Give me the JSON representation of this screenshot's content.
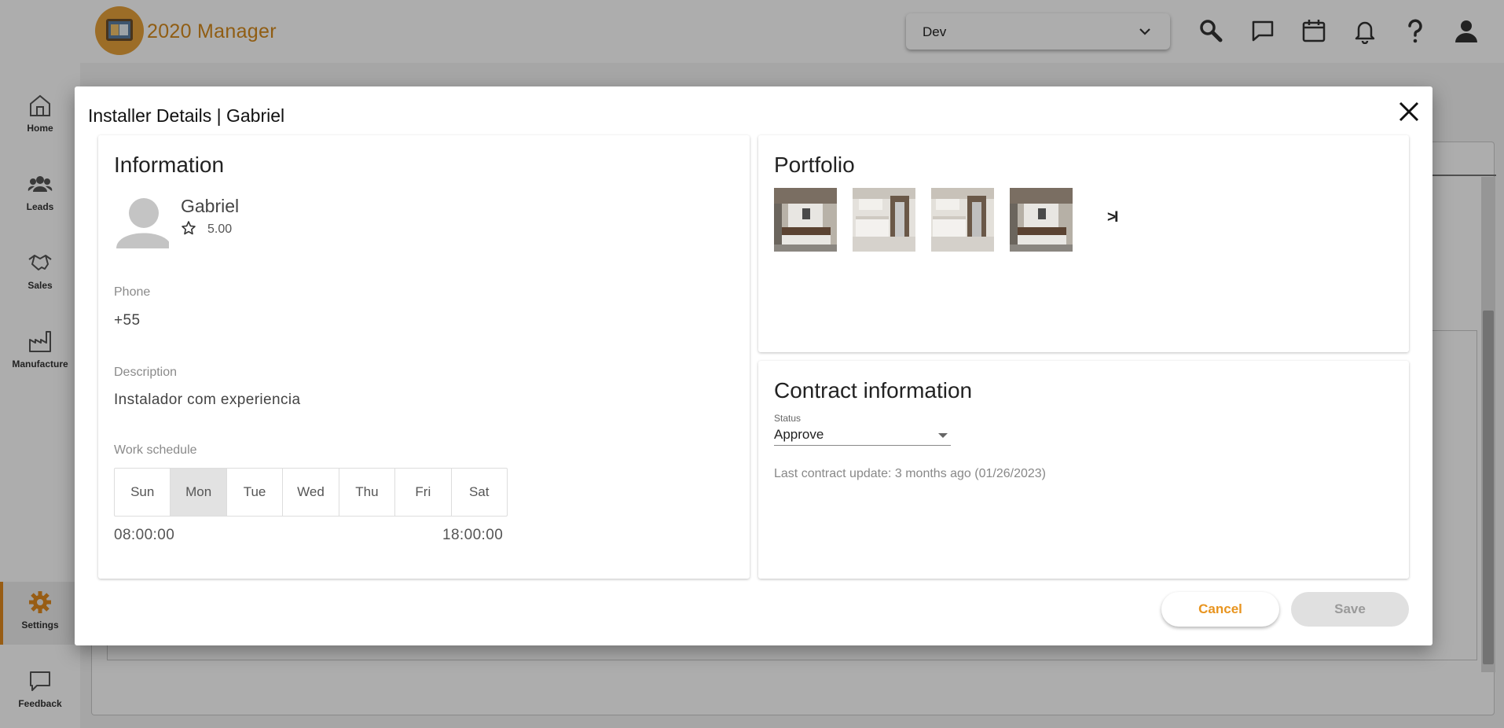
{
  "app": {
    "logo_text": "2020 Manager",
    "environment": "Dev",
    "accent_color": "#e08a1e"
  },
  "topbar_icons": [
    "search-icon",
    "chat-icon",
    "calendar-icon",
    "bell-icon",
    "help-icon",
    "user-icon"
  ],
  "sidebar": {
    "items": [
      {
        "label": "Home",
        "icon": "home-icon"
      },
      {
        "label": "Leads",
        "icon": "users-icon"
      },
      {
        "label": "Sales",
        "icon": "handshake-icon"
      },
      {
        "label": "Manufacture",
        "icon": "factory-icon"
      },
      {
        "label": "Settings",
        "icon": "gear-icon",
        "active": true
      },
      {
        "label": "Feedback",
        "icon": "feedback-icon"
      }
    ]
  },
  "modal": {
    "title": "Installer Details | Gabriel",
    "information": {
      "heading": "Information",
      "name": "Gabriel",
      "rating": "5.00",
      "phone_label": "Phone",
      "phone": "+55",
      "description_label": "Description",
      "description": "Instalador com experiencia",
      "schedule_label": "Work schedule",
      "days": [
        "Sun",
        "Mon",
        "Tue",
        "Wed",
        "Thu",
        "Fri",
        "Sat"
      ],
      "selected_day": "Mon",
      "start_time": "08:00:00",
      "end_time": "18:00:00"
    },
    "portfolio": {
      "heading": "Portfolio",
      "images": [
        "kitchen-photo-1",
        "kitchen-photo-2",
        "kitchen-photo-3",
        "kitchen-photo-4"
      ],
      "next_label": ">I"
    },
    "contract": {
      "heading": "Contract information",
      "status_label": "Status",
      "status_value": "Approve",
      "last_update": "Last contract update: 3 months ago (01/26/2023)"
    },
    "buttons": {
      "cancel": "Cancel",
      "save": "Save"
    }
  }
}
